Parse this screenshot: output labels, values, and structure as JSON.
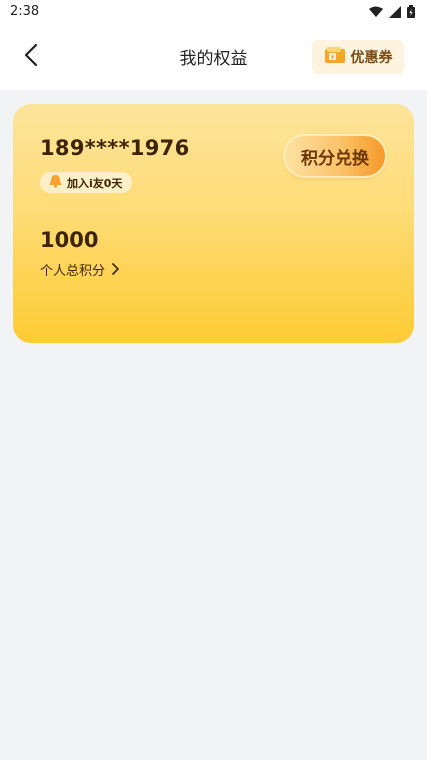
{
  "status_bar": {
    "time": "2:38"
  },
  "header": {
    "title": "我的权益",
    "coupon_label": "优惠券"
  },
  "card": {
    "phone": "189****1976",
    "join_badge": "加入i友0天",
    "points_value": "1000",
    "points_label": "个人总积分",
    "exchange_button": "积分兑换"
  },
  "colors": {
    "accent_orange": "#f59a28",
    "card_top": "#fde49c",
    "card_bottom": "#fdcb33",
    "text_brown": "#3d2405"
  }
}
